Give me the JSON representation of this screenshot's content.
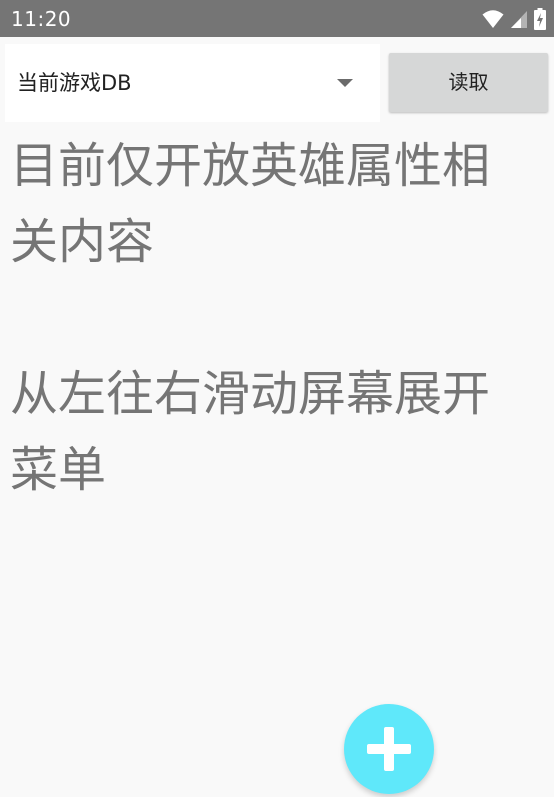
{
  "status_bar": {
    "time": "11:20",
    "icons": [
      "wifi-icon",
      "signal-icon",
      "battery-charging-icon"
    ]
  },
  "toolbar": {
    "spinner_value": "当前游戏DB",
    "read_button_label": "读取"
  },
  "content": {
    "message": "目前仅开放英雄属性相关内容\n\n从左往右滑动屏幕展开菜单"
  },
  "fab": {
    "icon": "plus-icon",
    "color": "#5fe8fa"
  },
  "colors": {
    "status_bar_bg": "#757575",
    "background": "#f9f9f9",
    "text_gray": "#757575",
    "button_bg": "#d6d7d7"
  }
}
